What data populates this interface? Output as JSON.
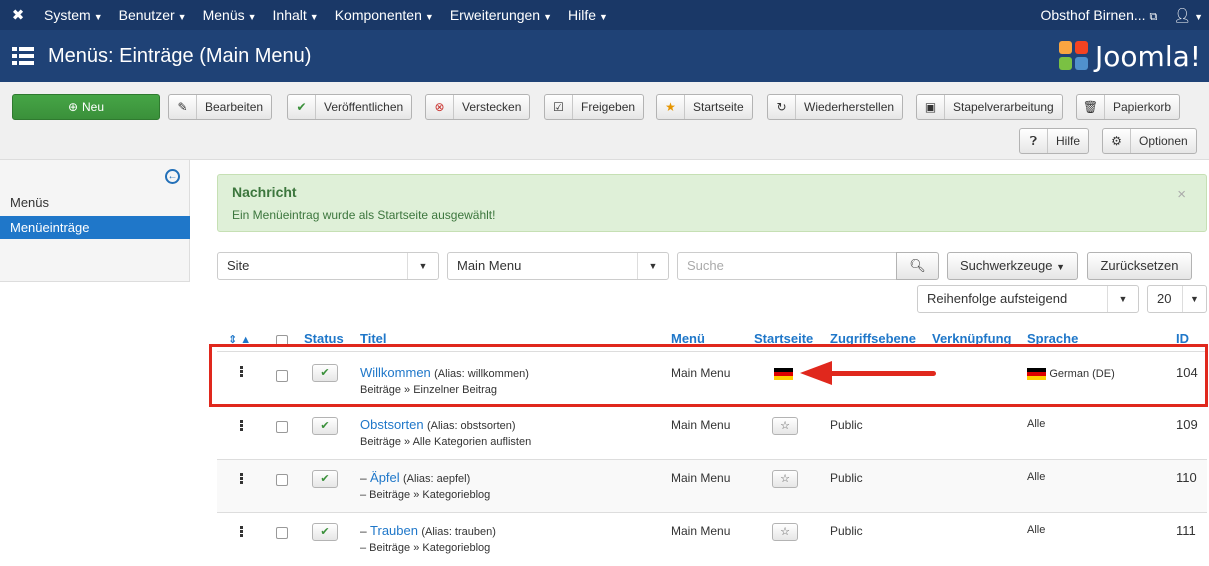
{
  "topnav": {
    "menus": [
      "System",
      "Benutzer",
      "Menüs",
      "Inhalt",
      "Komponenten",
      "Erweiterungen",
      "Hilfe"
    ],
    "site_link": "Obsthof Birnen...",
    "user_icon": "user-icon"
  },
  "header": {
    "title": "Menüs: Einträge (Main Menu)",
    "brand": "Joomla!"
  },
  "toolbar": {
    "new": "Neu",
    "edit": "Bearbeiten",
    "publish": "Veröffentlichen",
    "unpublish": "Verstecken",
    "checkin": "Freigeben",
    "home": "Startseite",
    "rebuild": "Wiederherstellen",
    "batch": "Stapelverarbeitung",
    "trash": "Papierkorb",
    "help": "Hilfe",
    "options": "Optionen"
  },
  "sidebar": {
    "items": [
      {
        "label": "Menüs",
        "active": false
      },
      {
        "label": "Menüeinträge",
        "active": true
      }
    ]
  },
  "alert": {
    "title": "Nachricht",
    "message": "Ein Menüeintrag wurde als Startseite ausgewählt!",
    "close": "×"
  },
  "filters": {
    "client": "Site",
    "menu": "Main Menu",
    "search_placeholder": "Suche",
    "search_tools": "Suchwerkzeuge",
    "reset": "Zurücksetzen",
    "ordering": "Reihenfolge aufsteigend",
    "limit": "20"
  },
  "table": {
    "headers": {
      "status": "Status",
      "title": "Titel",
      "menu": "Menü",
      "home": "Startseite",
      "access": "Zugriffsebene",
      "association": "Verknüpfung",
      "language": "Sprache",
      "id": "ID"
    },
    "rows": [
      {
        "prefix": "",
        "title": "Willkommen",
        "alias": "(Alias: willkommen)",
        "type": "Beiträge » Einzelner Beitrag",
        "menu": "Main Menu",
        "access": "",
        "language": "German (DE)",
        "id": "104",
        "is_home": true
      },
      {
        "prefix": "",
        "title": "Obstsorten",
        "alias": "(Alias: obstsorten)",
        "type": "Beiträge » Alle Kategorien auflisten",
        "menu": "Main Menu",
        "access": "Public",
        "language": "Alle",
        "id": "109",
        "is_home": false
      },
      {
        "prefix": "–",
        "title": "Äpfel",
        "alias": "(Alias: aepfel)",
        "type": "–  Beiträge » Kategorieblog",
        "menu": "Main Menu",
        "access": "Public",
        "language": "Alle",
        "id": "110",
        "is_home": false
      },
      {
        "prefix": "–",
        "title": "Trauben",
        "alias": "(Alias: trauben)",
        "type": "–  Beiträge » Kategorieblog",
        "menu": "Main Menu",
        "access": "Public",
        "language": "Alle",
        "id": "111",
        "is_home": false
      }
    ]
  },
  "colors": {
    "topnav": "#1a3867",
    "header": "#1f4276",
    "new_button": "#46a546",
    "link": "#1f77c9",
    "highlight": "#e0281d"
  }
}
